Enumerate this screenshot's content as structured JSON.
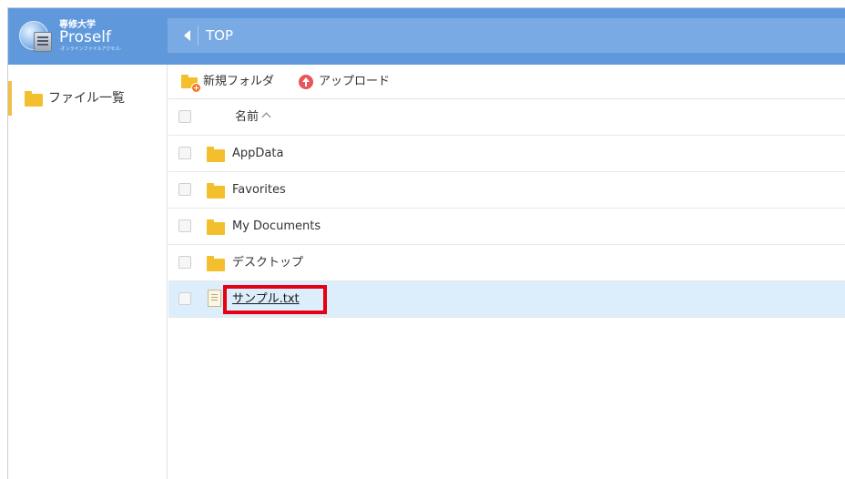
{
  "header": {
    "logo_university": "専修大学",
    "logo_name": "Proself",
    "logo_subtitle": "-オンラインファイルアクセス-",
    "breadcrumb": "TOP"
  },
  "sidebar": {
    "items": [
      {
        "label": "ファイル一覧",
        "icon": "folder-icon",
        "selected": true
      }
    ]
  },
  "toolbar": {
    "new_folder_label": "新規フォルダ",
    "upload_label": "アップロード"
  },
  "table": {
    "header_name": "名前",
    "sort_direction": "ascending",
    "rows": [
      {
        "name": "AppData",
        "type": "folder"
      },
      {
        "name": "Favorites",
        "type": "folder"
      },
      {
        "name": "My Documents",
        "type": "folder"
      },
      {
        "name": "デスクトップ",
        "type": "folder"
      },
      {
        "name": "サンプル.txt",
        "type": "file",
        "selected": true,
        "highlighted": true
      }
    ]
  },
  "colors": {
    "header_bg": "#5f99dc",
    "breadcrumb_bg": "#7aaae4",
    "folder": "#f3bf2c",
    "selected_row": "#dcedfb",
    "highlight_box": "#e60012",
    "sidebar_accent": "#f0c04a"
  }
}
